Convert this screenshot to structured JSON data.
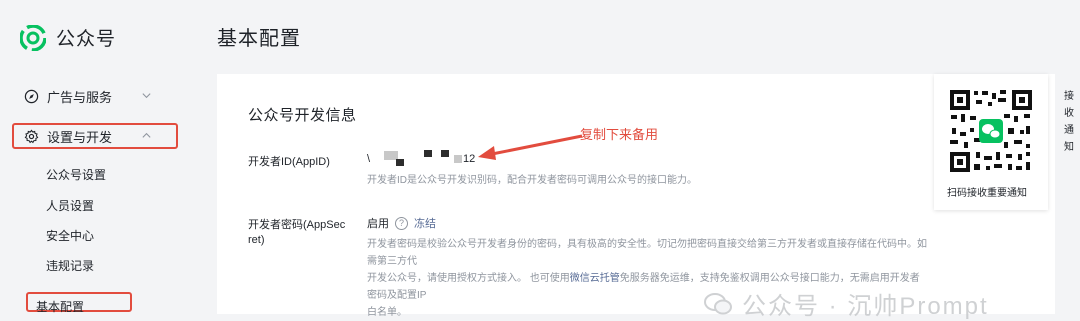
{
  "app": {
    "name": "公众号"
  },
  "sidebar": {
    "items": [
      {
        "label": "广告与服务",
        "icon": "compass-icon"
      },
      {
        "label": "设置与开发",
        "icon": "gear-icon"
      }
    ],
    "sub_items": [
      "公众号设置",
      "人员设置",
      "安全中心",
      "违规记录"
    ],
    "bottom_item": "基本配置"
  },
  "page": {
    "title": "基本配置"
  },
  "dev_info": {
    "section_title": "公众号开发信息",
    "appid_label": "开发者ID(AppID)",
    "appid_prefix": "\\",
    "appid_suffix": "12",
    "appid_hint": "开发者ID是公众号开发识别码，配合开发者密码可调用公众号的接口能力。",
    "secret_label_1": "开发者密码(AppSec",
    "secret_label_2": "ret)",
    "secret_status": "启用",
    "secret_action": "冻结",
    "secret_hint_line1": "开发者密码是校验公众号开发者身份的密码，具有极高的安全性。切记勿把密码直接交给第三方开发者或直接存储在代码中。如需第三方代",
    "secret_hint_line2_a": "开发公众号，请使用授权方式接入。 也可使用",
    "secret_hint_line2_link": "微信云托管",
    "secret_hint_line2_b": "免服务器免运维，支持免鉴权调用公众号接口能力，无需启用开发者密码及配置IP",
    "secret_hint_line3": "白名单。"
  },
  "annotation": {
    "text": "复制下来备用"
  },
  "qr": {
    "caption": "扫码接收重要通知"
  },
  "side_text": "接收通知",
  "watermark": {
    "text": "公众号 · 沉帅Prompt"
  },
  "colors": {
    "accent_red": "#e24c3e",
    "wechat_green": "#07c160",
    "link_blue": "#576b95"
  }
}
